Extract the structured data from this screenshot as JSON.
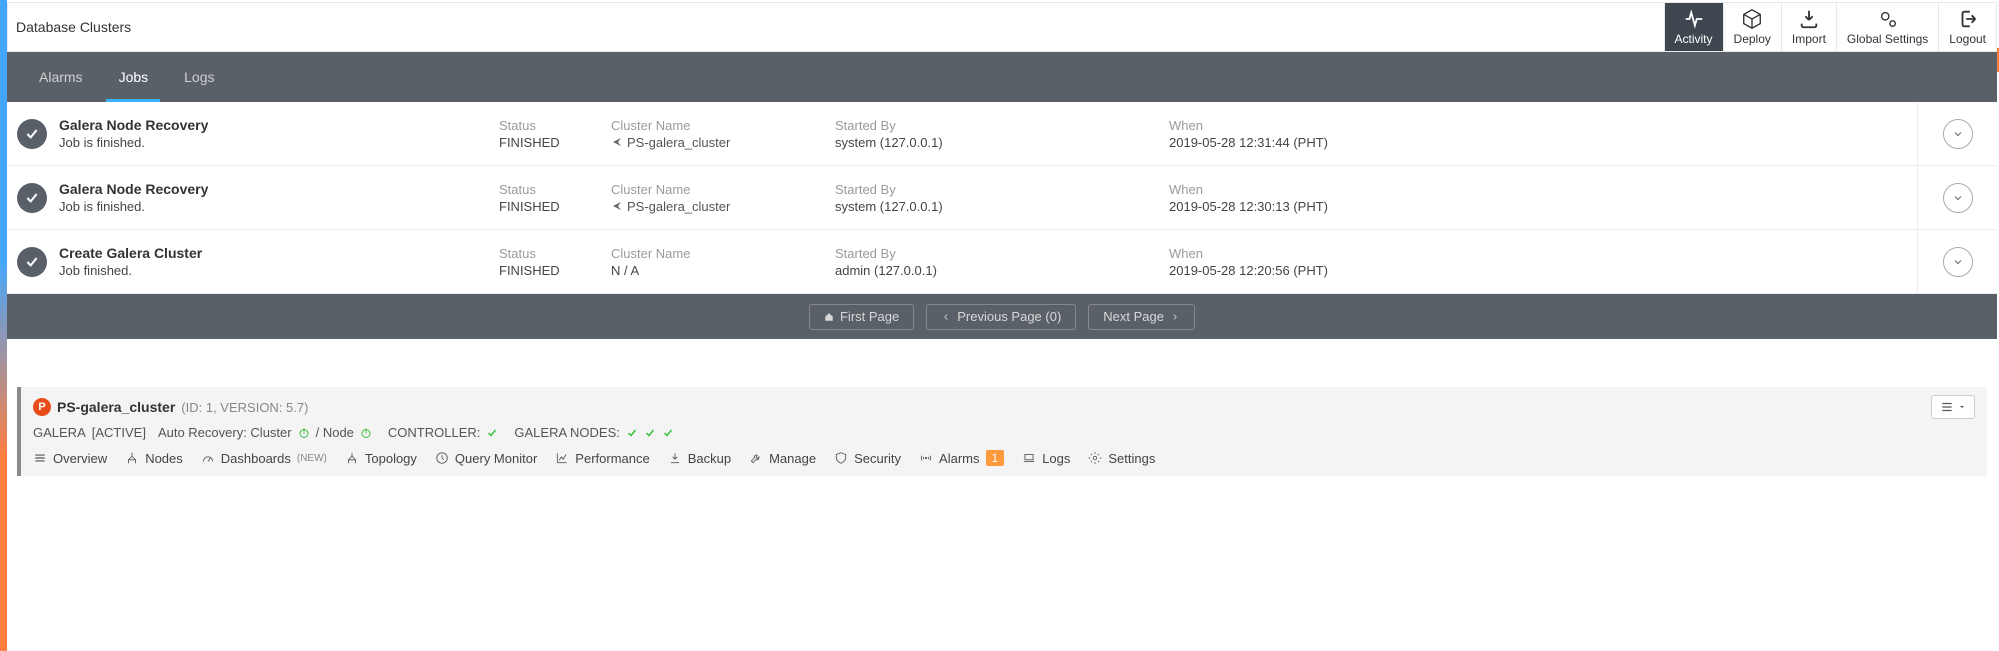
{
  "header": {
    "title": "Database Clusters",
    "actions": {
      "activity": "Activity",
      "deploy": "Deploy",
      "import": "Import",
      "settings": "Global Settings",
      "logout": "Logout"
    }
  },
  "tabs": {
    "alarms": "Alarms",
    "jobs": "Jobs",
    "logs": "Logs"
  },
  "labels": {
    "status": "Status",
    "cluster_name": "Cluster Name",
    "started_by": "Started By",
    "when": "When"
  },
  "jobs": [
    {
      "title": "Galera Node Recovery",
      "sub": "Job is finished.",
      "status": "FINISHED",
      "cluster": "PS-galera_cluster",
      "has_cluster_link": true,
      "by": "system (127.0.0.1)",
      "when": "2019-05-28 12:31:44 (PHT)"
    },
    {
      "title": "Galera Node Recovery",
      "sub": "Job is finished.",
      "status": "FINISHED",
      "cluster": "PS-galera_cluster",
      "has_cluster_link": true,
      "by": "system (127.0.0.1)",
      "when": "2019-05-28 12:30:13 (PHT)"
    },
    {
      "title": "Create Galera Cluster",
      "sub": "Job finished.",
      "status": "FINISHED",
      "cluster": "N / A",
      "has_cluster_link": false,
      "by": "admin (127.0.0.1)",
      "when": "2019-05-28 12:20:56 (PHT)"
    }
  ],
  "pager": {
    "first": "First Page",
    "prev": "Previous Page (0)",
    "next": "Next Page"
  },
  "cluster": {
    "name": "PS-galera_cluster",
    "meta": "(ID: 1, VERSION: 5.7)",
    "status_line": {
      "galera": "GALERA",
      "active": "[ACTIVE]",
      "auto_recovery": "Auto Recovery: Cluster",
      "node_sep": "/ Node",
      "controller": "CONTROLLER:",
      "galera_nodes": "GALERA NODES:"
    },
    "nav": {
      "overview": "Overview",
      "nodes": "Nodes",
      "dashboards": "Dashboards",
      "new": "(NEW)",
      "topology": "Topology",
      "query_monitor": "Query Monitor",
      "performance": "Performance",
      "backup": "Backup",
      "manage": "Manage",
      "security": "Security",
      "alarms": "Alarms",
      "alarm_count": "1",
      "logs": "Logs",
      "settings": "Settings"
    }
  }
}
